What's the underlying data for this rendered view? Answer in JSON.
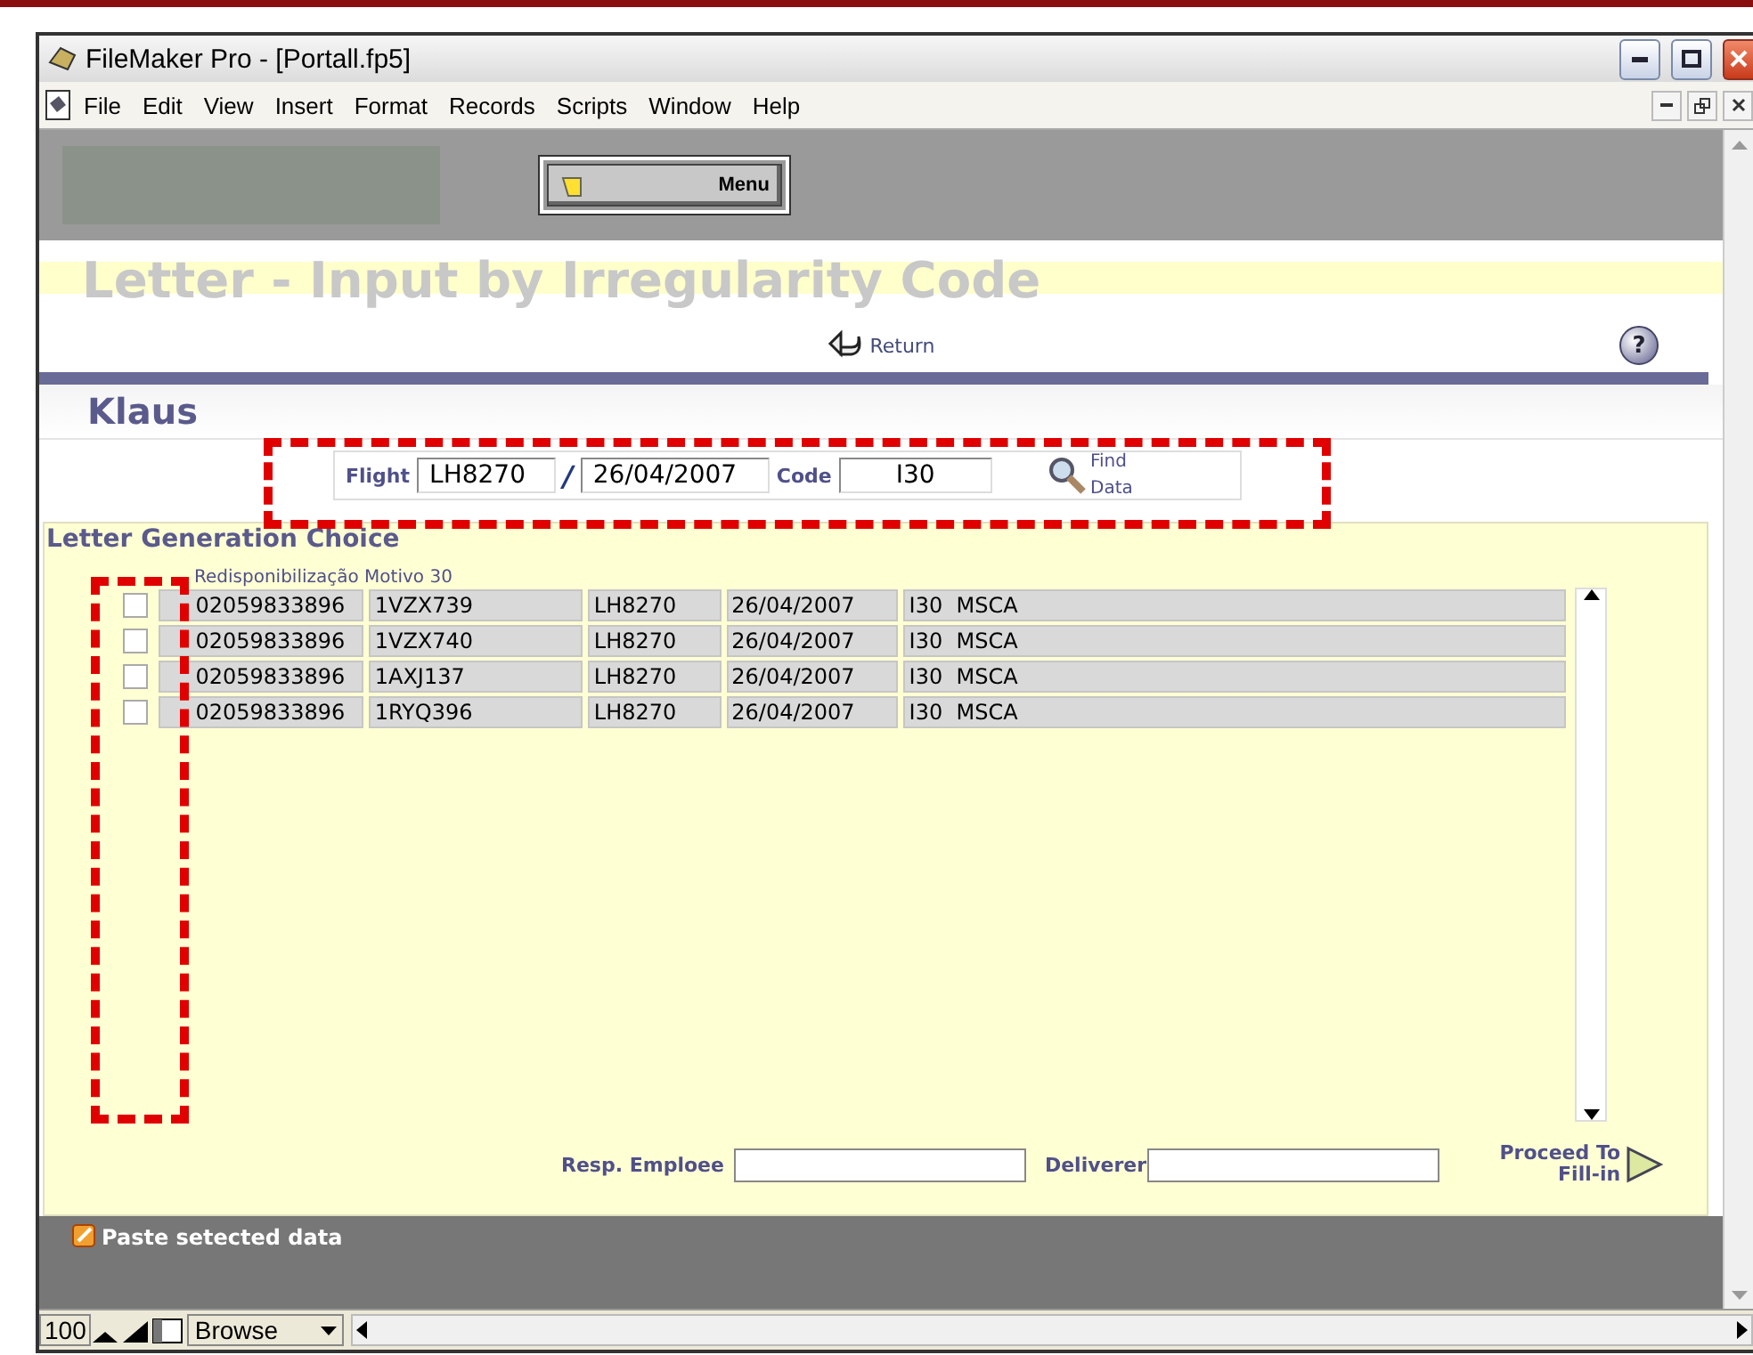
{
  "window": {
    "title": "FileMaker Pro - [Portall.fp5]"
  },
  "menu_bar": [
    "File",
    "Edit",
    "View",
    "Insert",
    "Format",
    "Records",
    "Scripts",
    "Window",
    "Help"
  ],
  "header": {
    "menu_button": "Menu"
  },
  "page_title": "Letter - Input by Irregularity Code",
  "return_link": "Return",
  "help_button": "?",
  "user_name": "Klaus",
  "search": {
    "flight_label": "Flight",
    "flight": "LH8270",
    "separator": "/",
    "date": "26/04/2007",
    "code_label": "Code",
    "code": "I30",
    "find_button": "Find Data"
  },
  "panel": {
    "title": "Letter Generation Choice",
    "group_label": "Redisponibilização Motivo 30",
    "rows": [
      {
        "checked": false,
        "cells": [
          "02059833896",
          "1VZX739",
          "LH8270",
          "26/04/2007",
          "I30  MSCA"
        ]
      },
      {
        "checked": false,
        "cells": [
          "02059833896",
          "1VZX740",
          "LH8270",
          "26/04/2007",
          "I30  MSCA"
        ]
      },
      {
        "checked": false,
        "cells": [
          "02059833896",
          "1AXJ137",
          "LH8270",
          "26/04/2007",
          "I30  MSCA"
        ]
      },
      {
        "checked": false,
        "cells": [
          "02059833896",
          "1RYQ396",
          "LH8270",
          "26/04/2007",
          "I30  MSCA"
        ]
      }
    ],
    "resp_employee_label": "Resp. Emploee",
    "deliverer_label": "Deliverer",
    "proceed_button": "Proceed To Fill-in"
  },
  "footer": {
    "paste_button": "Paste setected data"
  },
  "status_bar": {
    "zoom": "100",
    "mode": "Browse"
  }
}
